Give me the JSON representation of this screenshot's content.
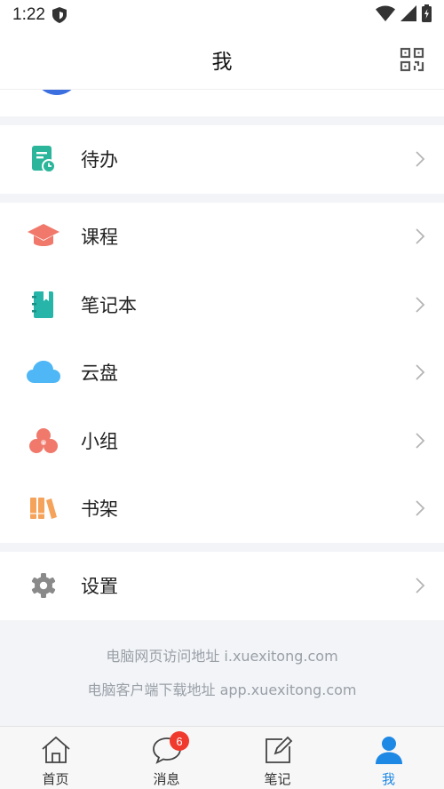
{
  "status_bar": {
    "time": "1:22"
  },
  "header": {
    "title": "我"
  },
  "sections": [
    {
      "items": [
        {
          "label": "待办",
          "icon": "todo-icon"
        }
      ]
    },
    {
      "items": [
        {
          "label": "课程",
          "icon": "graduation-cap-icon"
        },
        {
          "label": "笔记本",
          "icon": "notebook-icon"
        },
        {
          "label": "云盘",
          "icon": "cloud-icon"
        },
        {
          "label": "小组",
          "icon": "group-icon"
        },
        {
          "label": "书架",
          "icon": "bookshelf-icon"
        }
      ]
    },
    {
      "items": [
        {
          "label": "设置",
          "icon": "gear-icon"
        }
      ]
    }
  ],
  "footer": {
    "web_url_text": "电脑网页访问地址 i.xuexitong.com",
    "client_url_text": "电脑客户端下载地址 app.xuexitong.com"
  },
  "tabbar": {
    "tabs": [
      {
        "label": "首页",
        "icon": "home-icon"
      },
      {
        "label": "消息",
        "icon": "message-icon",
        "badge": "6"
      },
      {
        "label": "笔记",
        "icon": "note-edit-icon"
      },
      {
        "label": "我",
        "icon": "person-icon",
        "active": true
      }
    ]
  },
  "colors": {
    "accent": "#1e88e5",
    "todo": "#2bb59a",
    "course": "#f0796c",
    "notebook": "#26b5a8",
    "cloud": "#4fb7f5",
    "group": "#f0796c",
    "bookshelf": "#f5a25a",
    "gear": "#8a8a8a",
    "badge": "#f03a2e"
  }
}
